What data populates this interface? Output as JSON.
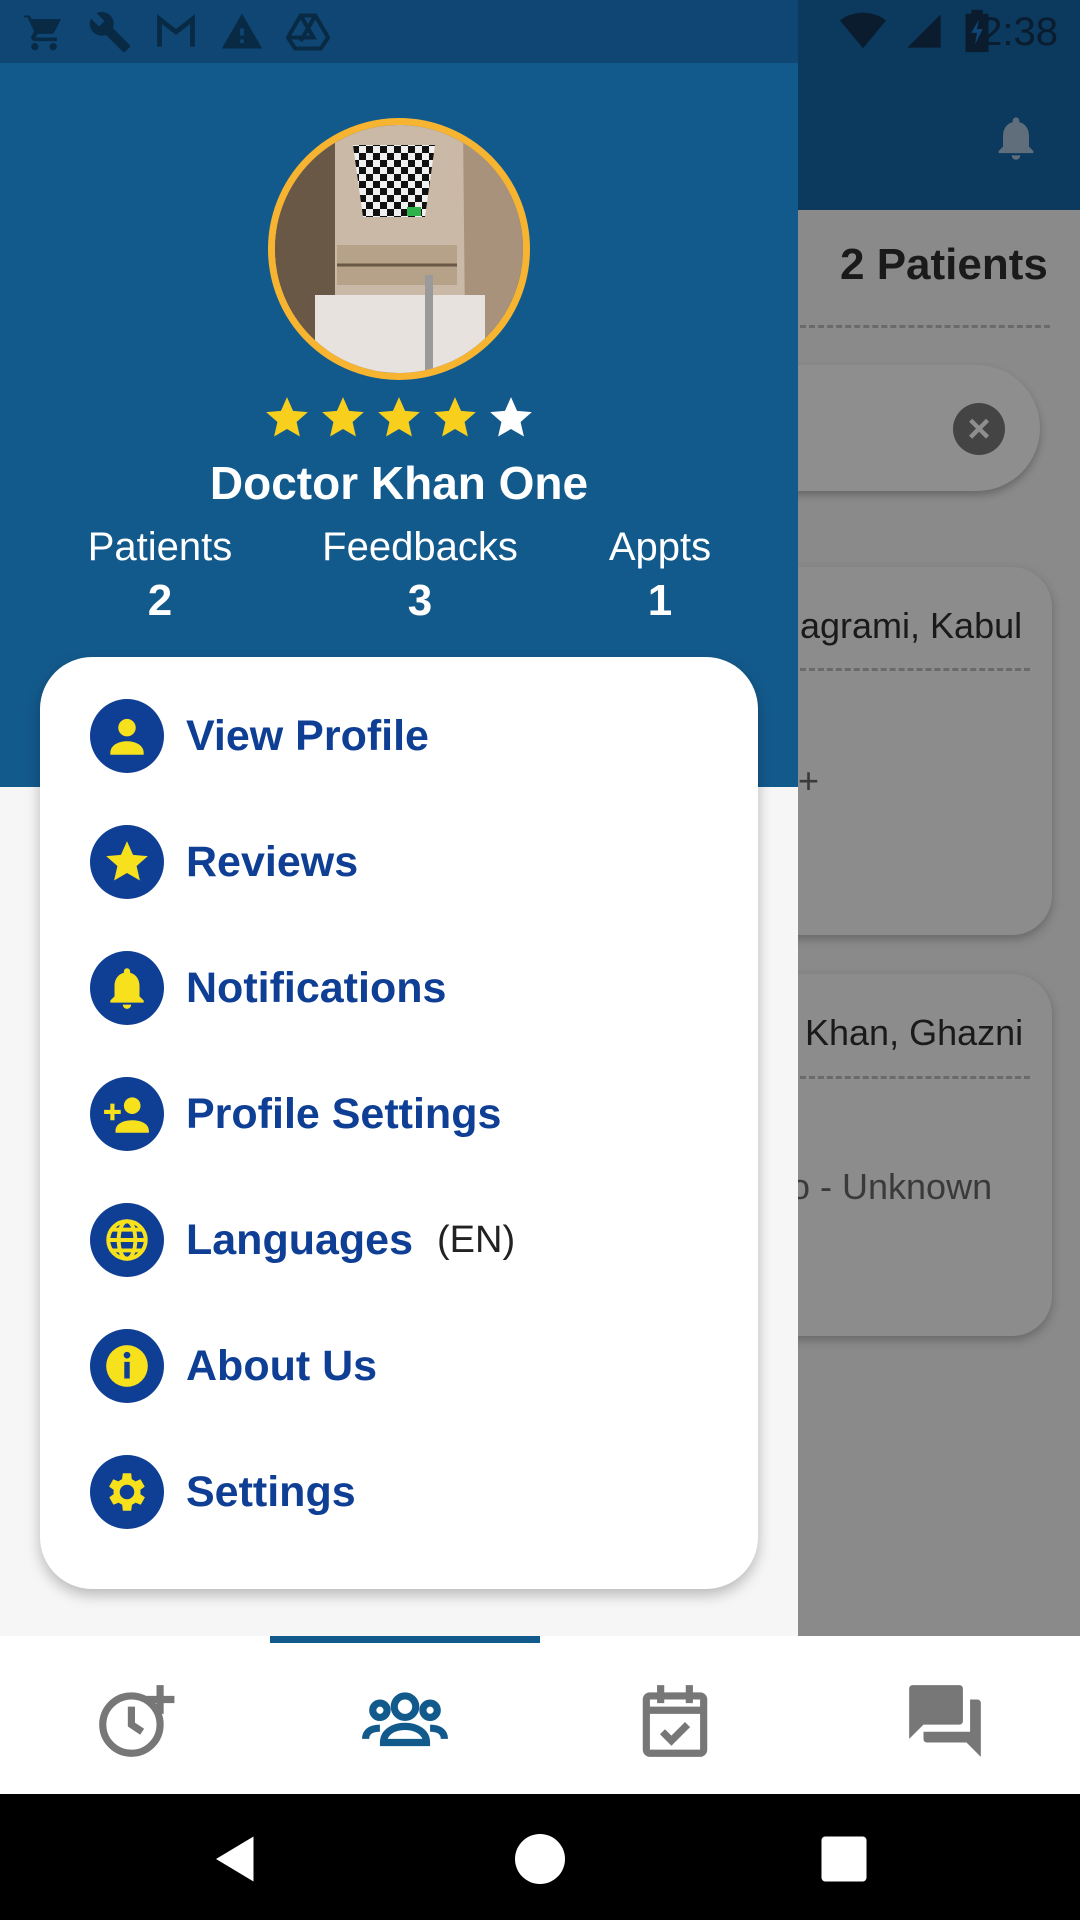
{
  "status_bar": {
    "time": "2:38",
    "left_icons": [
      "shopping-cart-icon",
      "wrench-icon",
      "gmail-icon",
      "warning-icon",
      "drive-icon"
    ],
    "right_icons": [
      "wifi-icon",
      "cell-signal-icon",
      "battery-icon"
    ]
  },
  "background_screen": {
    "patients_count": "2 Patients",
    "cards": [
      {
        "location": "agrami, Kabul",
        "detail": "+"
      },
      {
        "location": "Khan, Ghazni",
        "detail": "o - Unknown"
      }
    ]
  },
  "drawer": {
    "doctor_name": "Doctor Khan One",
    "rating": 4,
    "rating_max": 5,
    "stats": [
      {
        "label": "Patients",
        "value": "2"
      },
      {
        "label": "Feedbacks",
        "value": "3"
      },
      {
        "label": "Appts",
        "value": "1"
      }
    ],
    "menu": [
      {
        "label": "View Profile",
        "icon": "person-icon"
      },
      {
        "label": "Reviews",
        "icon": "star-icon"
      },
      {
        "label": "Notifications",
        "icon": "bell-icon"
      },
      {
        "label": "Profile Settings",
        "icon": "person-add-icon"
      },
      {
        "label": "Languages",
        "icon": "globe-icon",
        "extra": "(EN)"
      },
      {
        "label": "About Us",
        "icon": "info-icon"
      },
      {
        "label": "Settings",
        "icon": "gear-icon"
      }
    ]
  },
  "bottom_nav": {
    "items": [
      "clock-add-icon",
      "people-icon",
      "calendar-check-icon",
      "chat-icon"
    ],
    "active_index": 1
  },
  "colors": {
    "drawer_header": "#135a8c",
    "menu_accent": "#0f3e95",
    "icon_yellow": "#f7e01c",
    "avatar_border": "#f6b431"
  }
}
